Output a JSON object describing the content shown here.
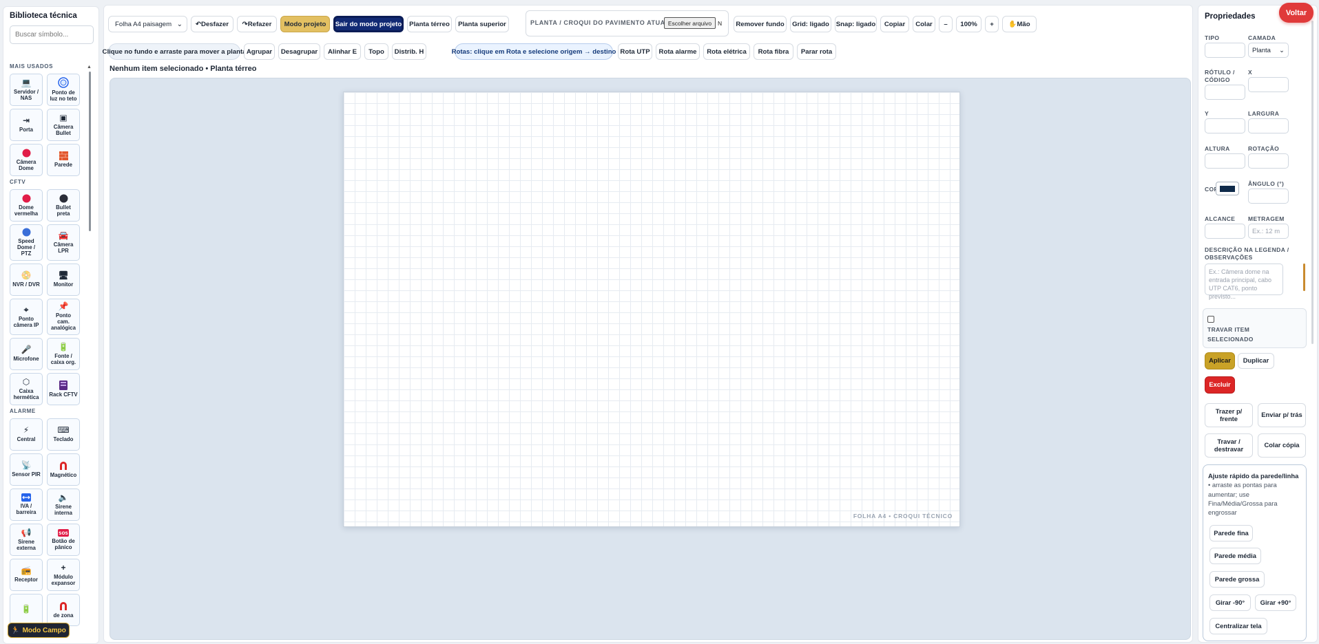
{
  "library": {
    "title": "Biblioteca técnica",
    "search_placeholder": "Buscar símbolo...",
    "sections": {
      "mais_usados": "MAIS USADOS",
      "cftv": "CFTV",
      "alarme": "ALARME"
    },
    "mais_usados": [
      "Servidor / NAS",
      "Ponto de luz no teto",
      "Porta",
      "Câmera Bullet",
      "Câmera Dome",
      "Parede"
    ],
    "cftv": [
      "Dome vermelha",
      "Bullet preta",
      "Speed Dome / PTZ",
      "Câmera LPR",
      "NVR / DVR",
      "Monitor",
      "Ponto câmera IP",
      "Ponto cam. analógica",
      "Microfone",
      "Fonte / caixa org.",
      "Caixa hermética",
      "Rack CFTV"
    ],
    "alarme": [
      "Central",
      "Teclado",
      "Sensor PIR",
      "Magnético",
      "IVA / barreira",
      "Sirene interna",
      "Sirene externa",
      "Botão de pânico",
      "Receptor",
      "Módulo expansor",
      "",
      "de zona"
    ],
    "modo_campo": "Modo Campo"
  },
  "toolbar": {
    "sheet_select": "Folha A4 paisagem",
    "undo": "Desfazer",
    "redo": "Refazer",
    "project_mode": "Modo projeto",
    "exit_project_mode": "Sair do modo projeto",
    "plant_ground": "Planta térreo",
    "plant_upper": "Planta superior",
    "plant_box_label": "PLANTA / CROQUI DO PAVIMENTO ATUAL",
    "choose_file": "Escolher arquivo",
    "file_status_fragment": "N",
    "remove_bg": "Remover fundo",
    "grid": "Grid: ligado",
    "snap": "Snap: ligado",
    "copy": "Copiar",
    "paste": "Colar",
    "zoom_out": "–",
    "zoom": "100%",
    "zoom_in": "+",
    "hand": "Mão"
  },
  "toolbar2": {
    "hint": "Clique no fundo e arraste para mover a planta",
    "group": "Agrupar",
    "ungroup": "Desagrupar",
    "align_left": "Alinhar E",
    "top": "Topo",
    "distrib_h": "Distrib. H",
    "routes_hint": "Rotas: clique em Rota e selecione origem → destino",
    "route_utp": "Rota UTP",
    "route_alarm": "Rota alarme",
    "route_electric": "Rota elétrica",
    "route_fiber": "Rota fibra",
    "stop_route": "Parar rota"
  },
  "status": "Nenhum item selecionado • Planta térreo",
  "sheet_label": "FOLHA A4 • CROQUI TÉCNICO",
  "properties": {
    "title": "Propriedades",
    "back": "Voltar",
    "tipo": "TIPO",
    "camada": "CAMADA",
    "camada_value": "Planta",
    "rotulo": "RÓTULO / CÓDIGO",
    "x": "X",
    "y": "Y",
    "largura": "LARGURA",
    "altura": "ALTURA",
    "rotacao": "ROTAÇÃO",
    "cor": "COR",
    "angulo": "ÂNGULO (°)",
    "alcance": "ALCANCE",
    "metragem": "METRAGEM",
    "metragem_placeholder": "Ex.: 12 m",
    "descricao": "DESCRIÇÃO NA LEGENDA / OBSERVAÇÕES",
    "descricao_placeholder": "Ex.: Câmera dome na entrada principal, cabo UTP CAT6, ponto previsto...",
    "travar": "TRAVAR ITEM SELECIONADO",
    "aplicar": "Aplicar",
    "duplicar": "Duplicar",
    "excluir": "Excluir",
    "trazer_frente": "Trazer p/ frente",
    "enviar_tras": "Enviar p/ trás",
    "travar_destravar": "Travar / destravar",
    "colar_copia": "Colar cópia",
    "wall_title": "Ajuste rápido da parede/linha",
    "wall_desc": "• arraste as pontas para aumentar; use Fina/Média/Grossa para engrossar",
    "parede_fina": "Parede fina",
    "parede_media": "Parede média",
    "parede_grossa": "Parede grossa",
    "girar_menos": "Girar -90°",
    "girar_mais": "Girar +90°",
    "centralizar": "Centralizar tela"
  },
  "colors": {
    "accent_yellow": "#e3c062",
    "navy": "#122a74",
    "danger": "#dc2626",
    "gold": "#c9a227",
    "canvas_bg": "#dbe4ee"
  }
}
